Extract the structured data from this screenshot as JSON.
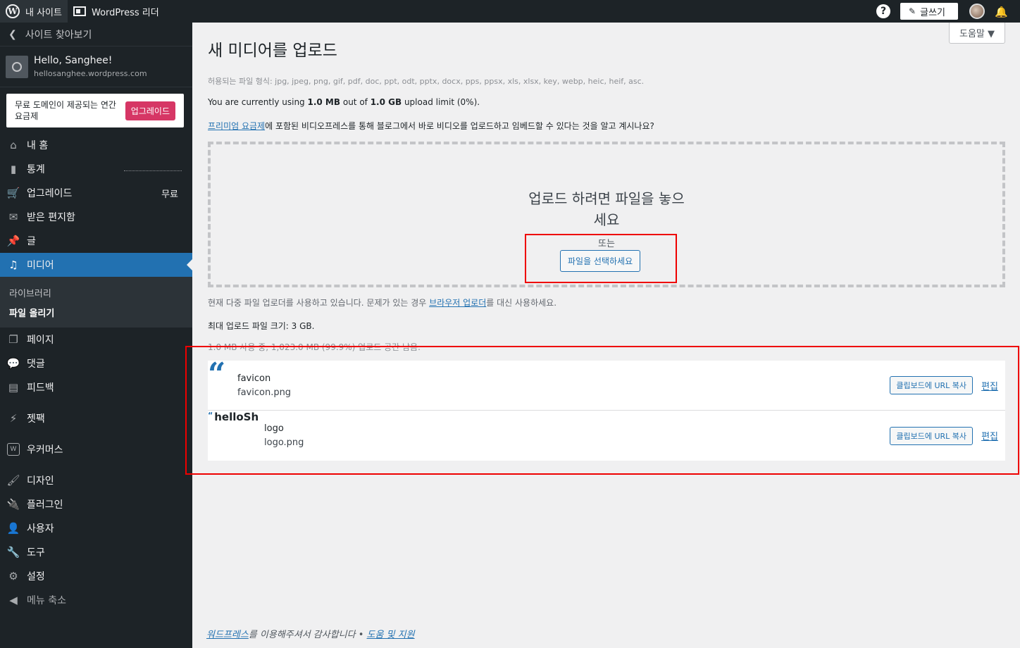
{
  "topbar": {
    "my_site": "내 사이트",
    "reader": "WordPress 리더",
    "write": "글쓰기"
  },
  "sidebar": {
    "back": "사이트 찾아보기",
    "site_name": "Hello, Sanghee!",
    "site_url": "hellosanghee.wordpress.com",
    "upgrade_text": "무료 도메인이 제공되는 연간 요금제",
    "upgrade_btn": "업그레이드",
    "items": [
      {
        "label": "내 홈",
        "icon": "home-icon"
      },
      {
        "label": "통계",
        "icon": "stats-icon"
      },
      {
        "label": "업그레이드",
        "icon": "cart-icon",
        "badge": "무료"
      },
      {
        "label": "받은 편지함",
        "icon": "mail-icon"
      },
      {
        "label": "글",
        "icon": "pin-icon"
      },
      {
        "label": "미디어",
        "icon": "media-icon"
      },
      {
        "label": "페이지",
        "icon": "pages-icon"
      },
      {
        "label": "댓글",
        "icon": "comment-icon"
      },
      {
        "label": "피드백",
        "icon": "feedback-icon"
      },
      {
        "label": "젯팩",
        "icon": "jetpack-icon"
      },
      {
        "label": "우커머스",
        "icon": "woo-icon"
      },
      {
        "label": "디자인",
        "icon": "brush-icon"
      },
      {
        "label": "플러그인",
        "icon": "plugin-icon"
      },
      {
        "label": "사용자",
        "icon": "user-icon"
      },
      {
        "label": "도구",
        "icon": "wrench-icon"
      },
      {
        "label": "설정",
        "icon": "settings-icon"
      },
      {
        "label": "메뉴 축소",
        "icon": "collapse-icon"
      }
    ],
    "submenu": [
      "라이브러리",
      "파일 올리기"
    ]
  },
  "main": {
    "help_tab": "도움말 ▼",
    "title": "새 미디어를 업로드",
    "allowed": "허용되는 파일 형식: jpg, jpeg, png, gif, pdf, doc, ppt, odt, pptx, docx, pps, ppsx, xls, xlsx, key, webp, heic, heif, asc.",
    "usage_pre": "You are currently using ",
    "usage_used": "1.0 MB",
    "usage_mid": " out of ",
    "usage_total": "1.0 GB",
    "usage_post": " upload limit (0%).",
    "promo_link": "프리미엄 요금제",
    "promo_text": "에 포함된 비디오프레스를 통해 블로그에서 바로 비디오를 업로드하고 임베드할 수 있다는 것을 알고 계시나요?",
    "drop_line1": "업로드 하려면 파일을 놓으",
    "drop_line2": "세요",
    "drop_or": "또는",
    "select_btn": "파일을 선택하세요",
    "multi_pre": "현재 다중 파일 업로더를 사용하고 있습니다. 문제가 있는 경우 ",
    "multi_link": "브라우저 업로더",
    "multi_post": "를 대신 사용하세요.",
    "maxsize": "최대 업로드 파일 크기: 3 GB.",
    "space": "1.0 MB 사용 중, 1,023.0 MB (99.9%) 업로드 공간 남음.",
    "media": [
      {
        "title": "favicon",
        "file": "favicon.png",
        "copy": "클립보드에 URL 복사",
        "edit": "편집"
      },
      {
        "title": "logo",
        "file": "logo.png",
        "copy": "클립보드에 URL 복사",
        "edit": "편집",
        "thumb_text": "helloSh"
      }
    ],
    "footer_link1": "워드프레스",
    "footer_text": "를 이용해주셔서 감사합니다 • ",
    "footer_link2": "도움 및 지원"
  }
}
